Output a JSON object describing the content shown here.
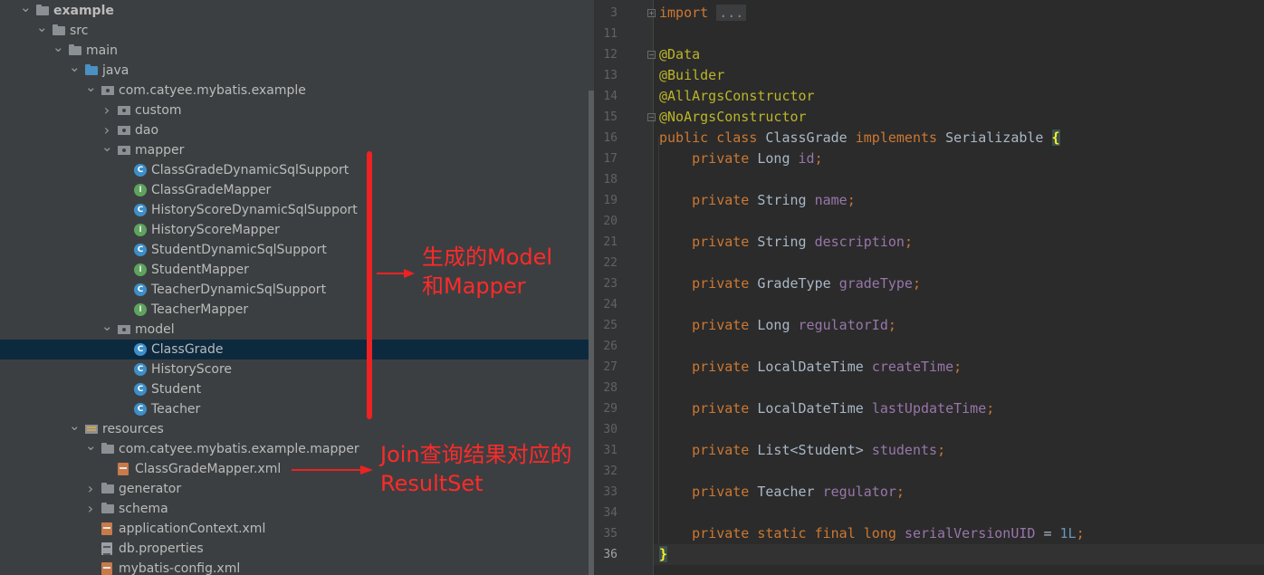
{
  "project_tree": {
    "rows": [
      {
        "label": "example",
        "depth": 0,
        "arrow": "open",
        "icon": "project-folder-icon",
        "bold": true
      },
      {
        "label": "src",
        "depth": 1,
        "arrow": "open",
        "icon": "folder-icon"
      },
      {
        "label": "main",
        "depth": 2,
        "arrow": "open",
        "icon": "folder-icon"
      },
      {
        "label": "java",
        "depth": 3,
        "arrow": "open",
        "icon": "source-folder-icon"
      },
      {
        "label": "com.catyee.mybatis.example",
        "depth": 4,
        "arrow": "open",
        "icon": "package-icon"
      },
      {
        "label": "custom",
        "depth": 5,
        "arrow": "closed",
        "icon": "package-icon"
      },
      {
        "label": "dao",
        "depth": 5,
        "arrow": "closed",
        "icon": "package-icon"
      },
      {
        "label": "mapper",
        "depth": 5,
        "arrow": "open",
        "icon": "package-icon"
      },
      {
        "label": "ClassGradeDynamicSqlSupport",
        "depth": 6,
        "arrow": "none",
        "icon": "class-icon"
      },
      {
        "label": "ClassGradeMapper",
        "depth": 6,
        "arrow": "none",
        "icon": "interface-icon"
      },
      {
        "label": "HistoryScoreDynamicSqlSupport",
        "depth": 6,
        "arrow": "none",
        "icon": "class-icon"
      },
      {
        "label": "HistoryScoreMapper",
        "depth": 6,
        "arrow": "none",
        "icon": "interface-icon"
      },
      {
        "label": "StudentDynamicSqlSupport",
        "depth": 6,
        "arrow": "none",
        "icon": "class-icon"
      },
      {
        "label": "StudentMapper",
        "depth": 6,
        "arrow": "none",
        "icon": "interface-icon"
      },
      {
        "label": "TeacherDynamicSqlSupport",
        "depth": 6,
        "arrow": "none",
        "icon": "class-icon"
      },
      {
        "label": "TeacherMapper",
        "depth": 6,
        "arrow": "none",
        "icon": "interface-icon"
      },
      {
        "label": "model",
        "depth": 5,
        "arrow": "open",
        "icon": "package-icon"
      },
      {
        "label": "ClassGrade",
        "depth": 6,
        "arrow": "none",
        "icon": "class-icon",
        "selected": true
      },
      {
        "label": "HistoryScore",
        "depth": 6,
        "arrow": "none",
        "icon": "class-icon"
      },
      {
        "label": "Student",
        "depth": 6,
        "arrow": "none",
        "icon": "class-icon"
      },
      {
        "label": "Teacher",
        "depth": 6,
        "arrow": "none",
        "icon": "class-icon"
      },
      {
        "label": "resources",
        "depth": 3,
        "arrow": "open",
        "icon": "resources-folder-icon"
      },
      {
        "label": "com.catyee.mybatis.example.mapper",
        "depth": 4,
        "arrow": "open",
        "icon": "folder-icon"
      },
      {
        "label": "ClassGradeMapper.xml",
        "depth": 5,
        "arrow": "none",
        "icon": "xml-file-icon"
      },
      {
        "label": "generator",
        "depth": 4,
        "arrow": "closed",
        "icon": "folder-icon"
      },
      {
        "label": "schema",
        "depth": 4,
        "arrow": "closed",
        "icon": "folder-icon"
      },
      {
        "label": "applicationContext.xml",
        "depth": 4,
        "arrow": "none",
        "icon": "xml-file-icon"
      },
      {
        "label": "db.properties",
        "depth": 4,
        "arrow": "none",
        "icon": "properties-file-icon"
      },
      {
        "label": "mybatis-config.xml",
        "depth": 4,
        "arrow": "none",
        "icon": "xml-file-icon"
      }
    ]
  },
  "annotations": {
    "model_mapper": {
      "line1": "生成的Model",
      "line2": "和Mapper"
    },
    "resultset": {
      "line1": "Join查询结果对应的",
      "line2": "ResultSet"
    },
    "color": "#ff2a2a"
  },
  "editor": {
    "current_line": "36",
    "lines": [
      {
        "n": "3",
        "tokens": [
          {
            "t": "import",
            "c": "kw"
          },
          {
            "t": " "
          },
          {
            "t": "...",
            "c": "fold-text"
          }
        ]
      },
      {
        "n": "11",
        "tokens": []
      },
      {
        "n": "12",
        "tokens": [
          {
            "t": "@Data",
            "c": "ann"
          }
        ]
      },
      {
        "n": "13",
        "tokens": [
          {
            "t": "@Builder",
            "c": "ann"
          }
        ]
      },
      {
        "n": "14",
        "tokens": [
          {
            "t": "@AllArgsConstructor",
            "c": "ann"
          }
        ]
      },
      {
        "n": "15",
        "tokens": [
          {
            "t": "@NoArgsConstructor",
            "c": "ann"
          }
        ]
      },
      {
        "n": "16",
        "tokens": [
          {
            "t": "public class ",
            "c": "kw"
          },
          {
            "t": "ClassGrade ",
            "c": "cls"
          },
          {
            "t": "implements ",
            "c": "kw"
          },
          {
            "t": "Serializable ",
            "c": "cls"
          },
          {
            "t": "{",
            "c": "brace-hl"
          }
        ]
      },
      {
        "n": "17",
        "tokens": [
          {
            "t": "    "
          },
          {
            "t": "private ",
            "c": "kw"
          },
          {
            "t": "Long ",
            "c": "cls"
          },
          {
            "t": "id",
            "c": "fld"
          },
          {
            "t": ";",
            "c": "kw"
          }
        ]
      },
      {
        "n": "18",
        "tokens": []
      },
      {
        "n": "19",
        "tokens": [
          {
            "t": "    "
          },
          {
            "t": "private ",
            "c": "kw"
          },
          {
            "t": "String ",
            "c": "cls"
          },
          {
            "t": "name",
            "c": "fld"
          },
          {
            "t": ";",
            "c": "kw"
          }
        ]
      },
      {
        "n": "20",
        "tokens": []
      },
      {
        "n": "21",
        "tokens": [
          {
            "t": "    "
          },
          {
            "t": "private ",
            "c": "kw"
          },
          {
            "t": "String ",
            "c": "cls"
          },
          {
            "t": "description",
            "c": "fld"
          },
          {
            "t": ";",
            "c": "kw"
          }
        ]
      },
      {
        "n": "22",
        "tokens": []
      },
      {
        "n": "23",
        "tokens": [
          {
            "t": "    "
          },
          {
            "t": "private ",
            "c": "kw"
          },
          {
            "t": "GradeType ",
            "c": "cls"
          },
          {
            "t": "gradeType",
            "c": "fld"
          },
          {
            "t": ";",
            "c": "kw"
          }
        ]
      },
      {
        "n": "24",
        "tokens": []
      },
      {
        "n": "25",
        "tokens": [
          {
            "t": "    "
          },
          {
            "t": "private ",
            "c": "kw"
          },
          {
            "t": "Long ",
            "c": "cls"
          },
          {
            "t": "regulatorId",
            "c": "fld"
          },
          {
            "t": ";",
            "c": "kw"
          }
        ]
      },
      {
        "n": "26",
        "tokens": []
      },
      {
        "n": "27",
        "tokens": [
          {
            "t": "    "
          },
          {
            "t": "private ",
            "c": "kw"
          },
          {
            "t": "LocalDateTime ",
            "c": "cls"
          },
          {
            "t": "createTime",
            "c": "fld"
          },
          {
            "t": ";",
            "c": "kw"
          }
        ]
      },
      {
        "n": "28",
        "tokens": []
      },
      {
        "n": "29",
        "tokens": [
          {
            "t": "    "
          },
          {
            "t": "private ",
            "c": "kw"
          },
          {
            "t": "LocalDateTime ",
            "c": "cls"
          },
          {
            "t": "lastUpdateTime",
            "c": "fld"
          },
          {
            "t": ";",
            "c": "kw"
          }
        ]
      },
      {
        "n": "30",
        "tokens": []
      },
      {
        "n": "31",
        "tokens": [
          {
            "t": "    "
          },
          {
            "t": "private ",
            "c": "kw"
          },
          {
            "t": "List<Student> ",
            "c": "cls"
          },
          {
            "t": "students",
            "c": "fld"
          },
          {
            "t": ";",
            "c": "kw"
          }
        ]
      },
      {
        "n": "32",
        "tokens": []
      },
      {
        "n": "33",
        "tokens": [
          {
            "t": "    "
          },
          {
            "t": "private ",
            "c": "kw"
          },
          {
            "t": "Teacher ",
            "c": "cls"
          },
          {
            "t": "regulator",
            "c": "fld"
          },
          {
            "t": ";",
            "c": "kw"
          }
        ]
      },
      {
        "n": "34",
        "tokens": []
      },
      {
        "n": "35",
        "tokens": [
          {
            "t": "    "
          },
          {
            "t": "private static final long ",
            "c": "kw"
          },
          {
            "t": "serialVersionUID",
            "c": "fld"
          },
          {
            "t": " = ",
            "c": "cls"
          },
          {
            "t": "1L",
            "c": "num"
          },
          {
            "t": ";",
            "c": "kw"
          }
        ]
      },
      {
        "n": "36",
        "tokens": [
          {
            "t": "}",
            "c": "brace-hl"
          }
        ]
      }
    ]
  }
}
